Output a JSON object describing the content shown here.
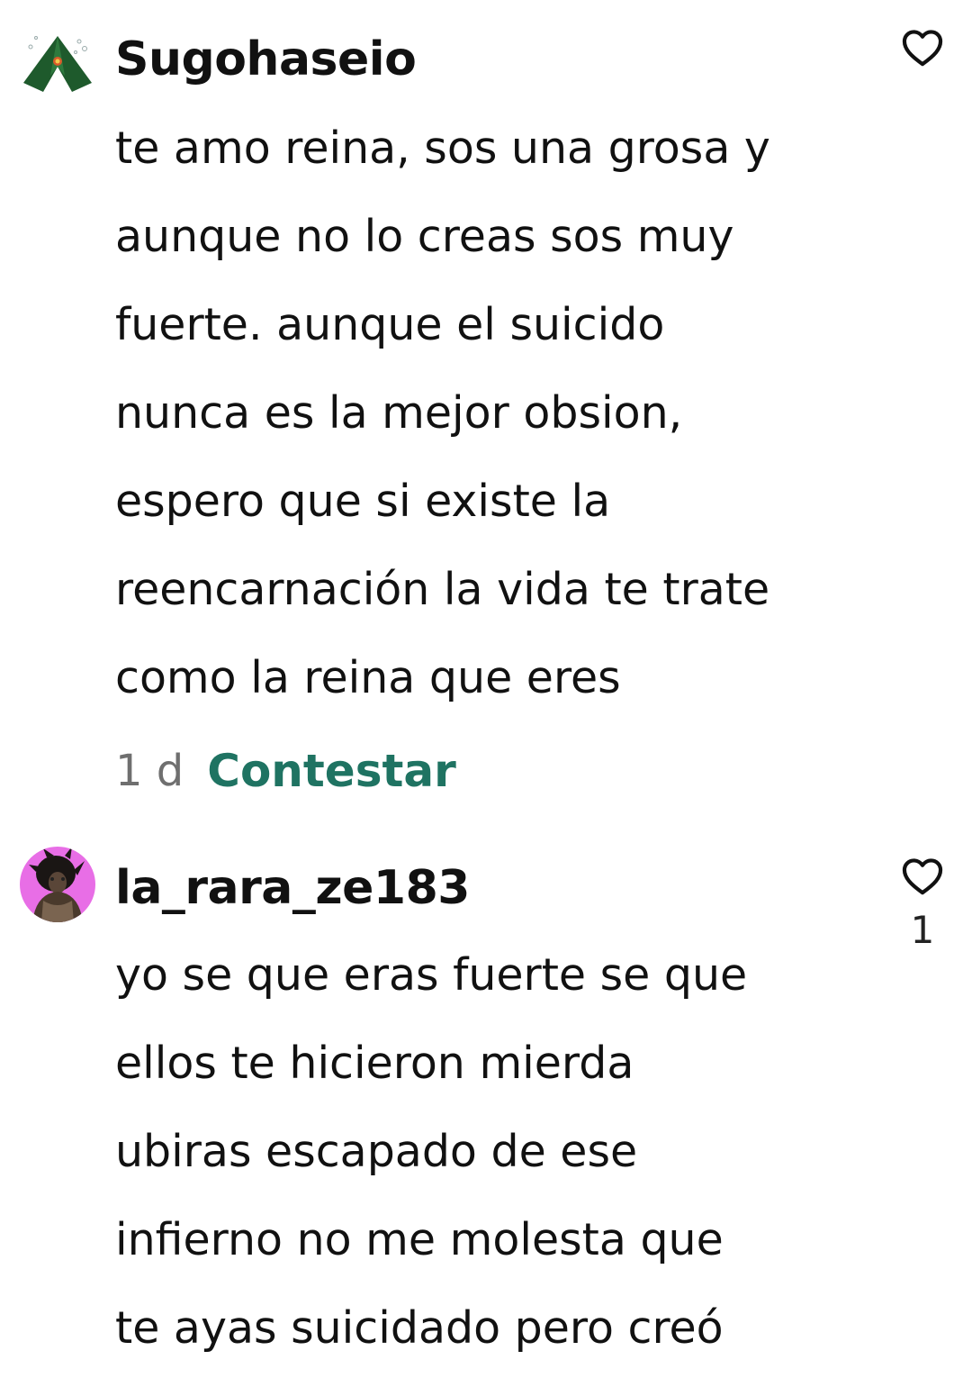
{
  "comments": [
    {
      "username": "Sugohaseio",
      "avatar_icon": "green-tent-avatar",
      "lines": [
        "te amo reina, sos una grosa y",
        "aunque no lo creas sos muy",
        "fuerte. aunque el suicido",
        "nunca es la mejor obsion,",
        "espero que si existe la",
        "reencarnación la vida te trate",
        "como la reina que eres"
      ],
      "age": "1 d",
      "reply_label": "Contestar",
      "like_icon": "heart-outline-icon"
    },
    {
      "username": "la_rara_ze183",
      "avatar_icon": "dark-figure-avatar",
      "lines": [
        "yo se que eras fuerte se que",
        "ellos te hicieron mierda",
        "ubiras escapado de ese",
        "infierno no me molesta que",
        "te ayas suicidado pero creó"
      ],
      "like_icon": "heart-outline-icon",
      "like_count": "1"
    }
  ],
  "colors": {
    "reply": "#1f7362",
    "age": "#6f6f6f",
    "text": "#111111",
    "avatar1_bg": "#1e5a2c",
    "avatar2_bg": "#e86ee6"
  }
}
